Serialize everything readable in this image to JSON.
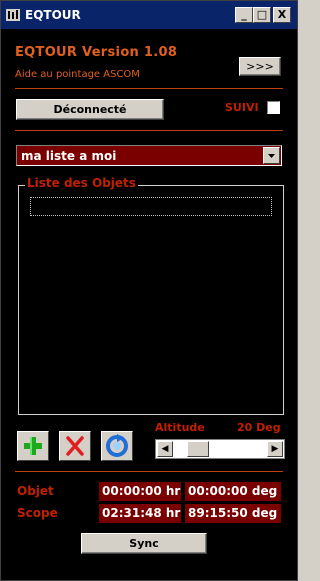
{
  "window": {
    "title": "EQTOUR",
    "controls": [
      "_",
      "□",
      "X"
    ]
  },
  "header": {
    "version": "EQTOUR Version 1.08",
    "subtitle": "Aide au pointage ASCOM",
    "more_button": ">>>"
  },
  "connection": {
    "button_label": "Déconnecté",
    "suivi_label": "SUIVI",
    "suivi_checked": false
  },
  "list_select": {
    "selected": "ma liste a moi"
  },
  "objects": {
    "group_label": "Liste des Objets",
    "items": []
  },
  "toolbar": {
    "add_icon": "add-icon",
    "delete_icon": "delete-icon",
    "refresh_icon": "refresh-icon"
  },
  "altitude": {
    "label": "Altitude",
    "value": "20 Deg",
    "slider_fraction": 0.2
  },
  "coords": {
    "objet_label": "Objet",
    "objet_ra": "00:00:00 hr",
    "objet_dec": "00:00:00 deg",
    "scope_label": "Scope",
    "scope_ra": "02:31:48 hr",
    "scope_dec": "89:15:50 deg"
  },
  "sync_button": "Sync",
  "colors": {
    "accent_orange": "#e06020",
    "label_red": "#c02000",
    "field_bg": "#7a0000",
    "separator": "#c04010"
  }
}
